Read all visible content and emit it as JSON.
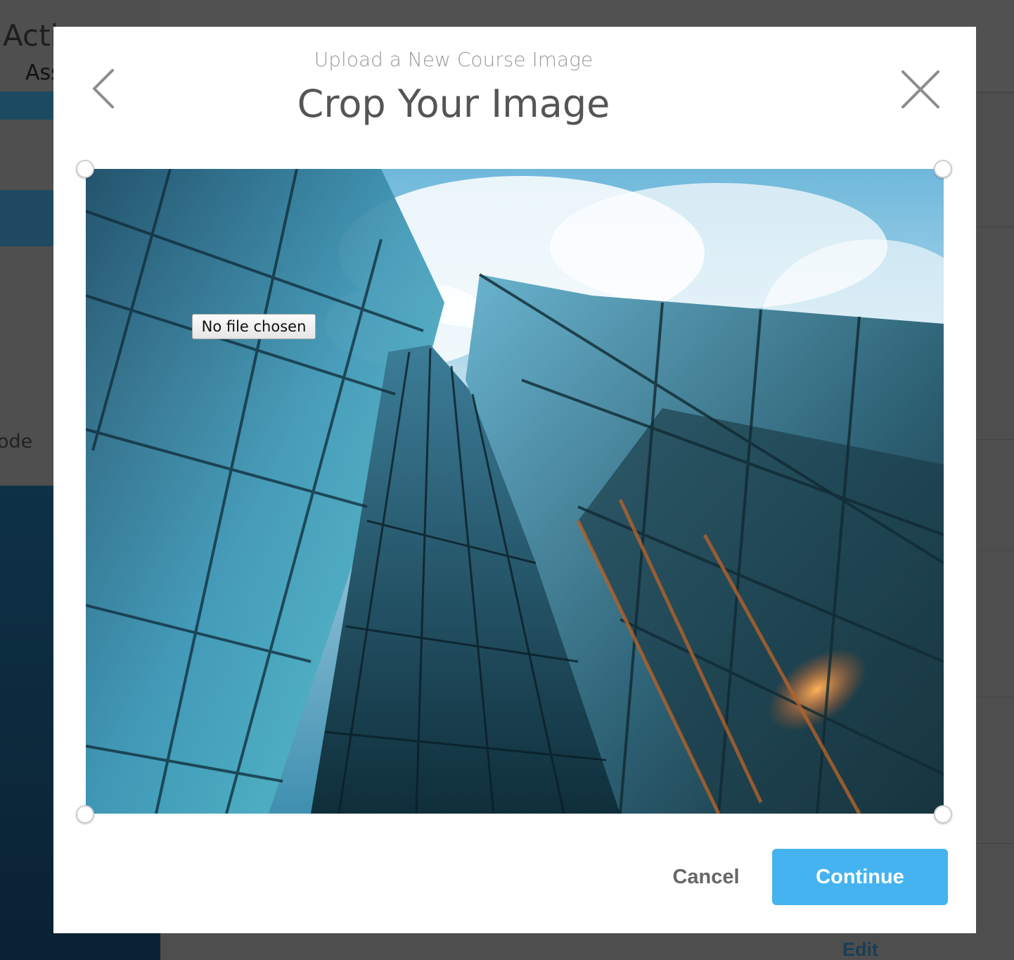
{
  "background": {
    "page_title": "Acti",
    "page_subtitle": "Ass",
    "sidebar_label": "ode",
    "edit_link": "Edit"
  },
  "modal": {
    "subtitle": "Upload a New Course Image",
    "title": "Crop Your Image",
    "back_icon": "chevron-left-icon",
    "close_icon": "close-icon",
    "file_input_label": "No file chosen",
    "cancel_label": "Cancel",
    "continue_label": "Continue",
    "accent_color": "#45b3ef"
  }
}
